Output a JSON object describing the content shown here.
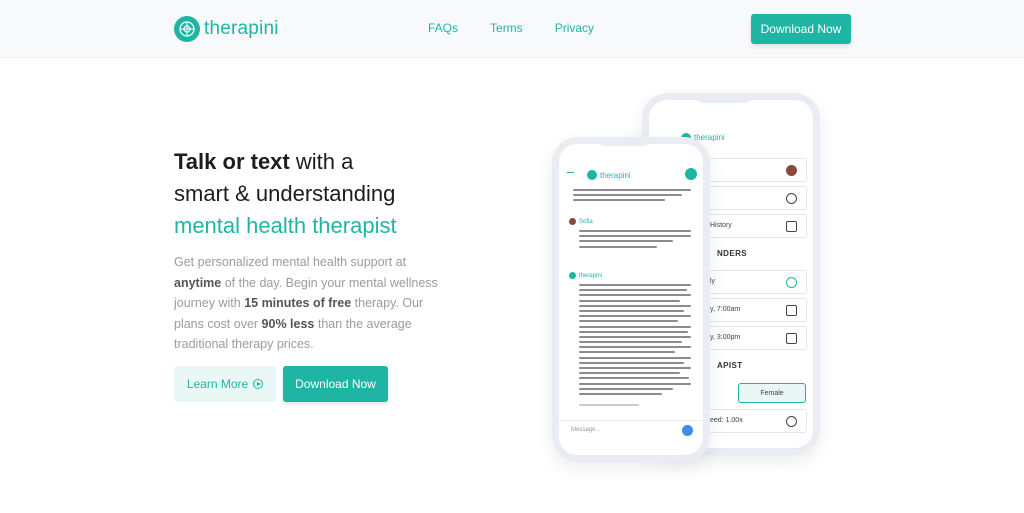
{
  "header": {
    "logo_text": "therapini",
    "nav": [
      "FAQs",
      "Terms",
      "Privacy"
    ],
    "cta_label": "Download Now"
  },
  "hero": {
    "headline_strong": "Talk or text",
    "headline_rest1": " with a",
    "headline_line2": "smart & understanding",
    "headline_accent": "mental health therapist",
    "desc_1": "Get personalized mental health support at ",
    "desc_b1": "anytime",
    "desc_2": " of the day. Begin your mental wellness journey with ",
    "desc_b2": "15 minutes of free",
    "desc_3": " therapy. Our plans cost over ",
    "desc_b3": "90% less",
    "desc_4": " than the average traditional therapy prices.",
    "learn_more_label": "Learn More",
    "download_label": "Download Now"
  },
  "phone_front": {
    "logo_text": "therapini",
    "sender_user": "Sofia",
    "sender_therapist": "therapini",
    "input_placeholder": "Message..."
  },
  "phone_back": {
    "logo_text": "therapini",
    "row_history": "History",
    "section_reminders": "NDERS",
    "row_daily": "ly",
    "row_time1": "y, 7:00am",
    "row_time2": "y, 3:00pm",
    "section_therapist": "APIST",
    "female_label": "Female",
    "row_speed": "eed: 1.00x"
  },
  "colors": {
    "accent": "#1fb5a4",
    "accent_light": "#e9f7f5",
    "text_dark": "#1d1d1f",
    "text_muted": "#9a9ba0"
  }
}
